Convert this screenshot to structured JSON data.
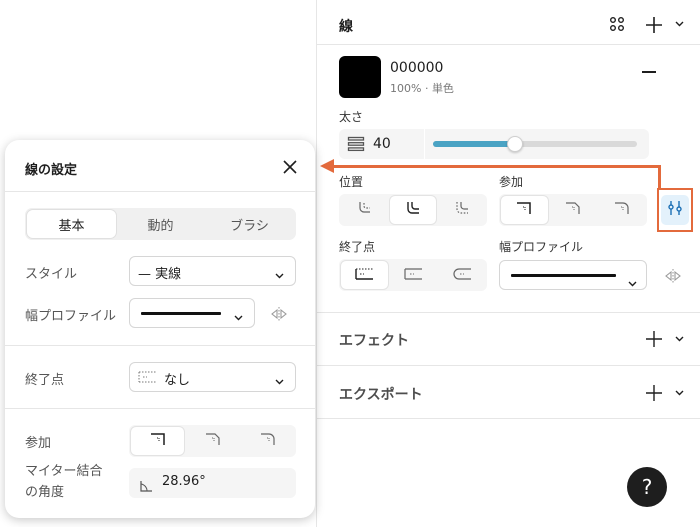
{
  "stroke_section": {
    "title": "線",
    "color_hex": "000000",
    "color_meta": "100% · 単色",
    "weight_label": "太さ",
    "weight_value": "40",
    "weight_slider_fraction": 0.4,
    "position_label": "位置",
    "join_label": "参加",
    "endpoint_label": "終了点",
    "width_profile_label": "幅プロファイル"
  },
  "effects_section": {
    "title": "エフェクト"
  },
  "export_section": {
    "title": "エクスポート"
  },
  "help": {
    "label": "?"
  },
  "dialog": {
    "title": "線の設定",
    "tabs": [
      "基本",
      "動的",
      "ブラシ"
    ],
    "style_label": "スタイル",
    "style_value": "— 実線",
    "width_profile_label": "幅プロファイル",
    "endpoint_label": "終了点",
    "endpoint_value": "なし",
    "join_label": "参加",
    "miter_label_line1": "マイター結合",
    "miter_label_line2": "の角度",
    "miter_value": "28.96°"
  },
  "colors": {
    "accent": "#e36a3c",
    "slider": "#4aa3c4",
    "highlight_bg": "#e3f1fb",
    "highlight_icon": "#1b6fb5"
  },
  "icons": [
    "grid-icon",
    "plus-icon",
    "chevron-down-icon",
    "minus-icon",
    "stroke-weight-icon",
    "stroke-inside-icon",
    "stroke-center-icon",
    "stroke-outside-icon",
    "join-miter-icon",
    "join-bevel-icon",
    "join-round-icon",
    "cap-none-icon",
    "cap-square-icon",
    "cap-round-icon",
    "flip-icon",
    "settings-sliders-icon",
    "close-icon",
    "dashed-line-icon",
    "angle-icon"
  ]
}
